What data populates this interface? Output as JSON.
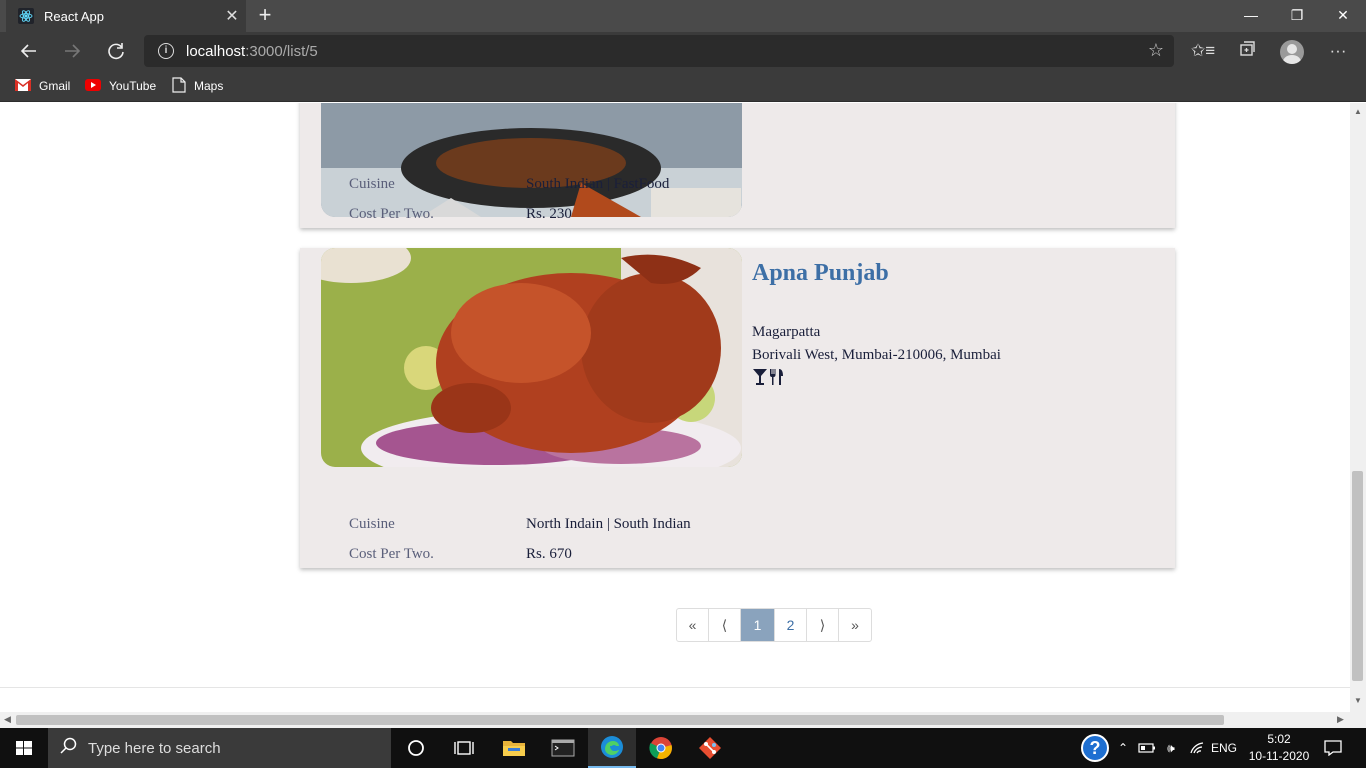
{
  "browser": {
    "tab_title": "React App",
    "tab_close": "✕",
    "new_tab": "+",
    "minimize": "—",
    "restore": "❐",
    "close": "✕",
    "url_host": "localhost",
    "url_path": ":3000/list/5",
    "bookmarks": [
      {
        "label": "Gmail",
        "icon": "gmail-icon"
      },
      {
        "label": "YouTube",
        "icon": "youtube-icon"
      },
      {
        "label": "Maps",
        "icon": "page-icon"
      }
    ],
    "accent": "#3b3b3b"
  },
  "restaurants": [
    {
      "name": "",
      "address_line1": "",
      "address_line2": "",
      "cuisine_label": "Cuisine",
      "cuisine_value": "South Indian | FastFood",
      "cost_label": "Cost Per Two.",
      "cost_value": "Rs. 230"
    },
    {
      "name": "Apna Punjab",
      "address_line1": "Magarpatta",
      "address_line2": "Borivali West, Mumbai-210006, Mumbai",
      "cuisine_label": "Cuisine",
      "cuisine_value": "North Indain | South Indian",
      "cost_label": "Cost Per Two.",
      "cost_value": "Rs. 670"
    }
  ],
  "pagination": {
    "first": "«",
    "prev": "⟨",
    "pages": [
      "1",
      "2"
    ],
    "active_page": "1",
    "next": "⟩",
    "last": "»"
  },
  "taskbar": {
    "search_placeholder": "Type here to search",
    "language": "ENG",
    "time": "5:02",
    "date": "10-11-2020"
  },
  "colors": {
    "title_blue": "#3d6fa6",
    "card_bg": "#eeeaea",
    "active_page_bg": "#8aa3bd"
  }
}
